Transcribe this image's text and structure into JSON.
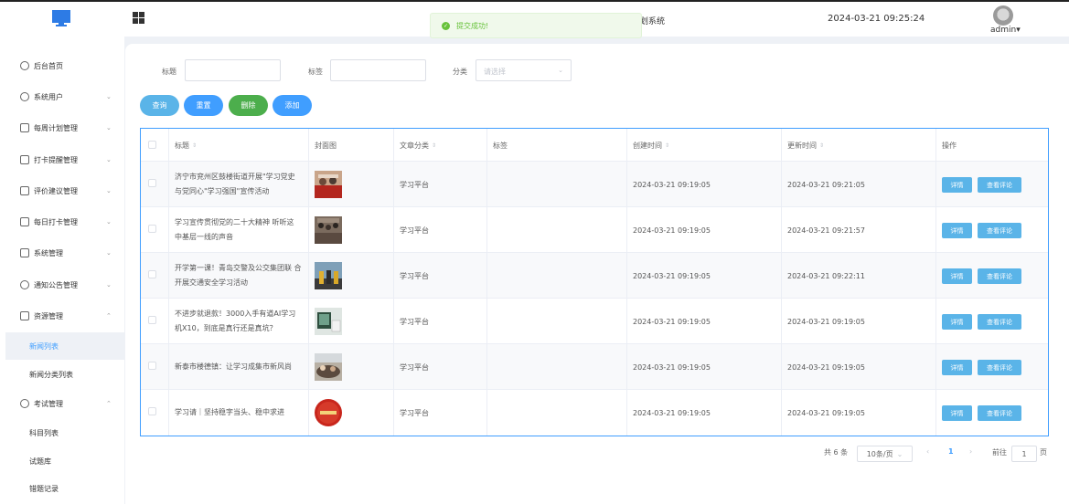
{
  "header": {
    "system_title_partial": "划系统",
    "datetime": "2024-03-21 09:25:24",
    "username": "admin",
    "dropdown_glyph": "▾"
  },
  "toast": {
    "message": "提交成功!",
    "icon": "check-circle-icon"
  },
  "sidebar": {
    "items": [
      {
        "label": "后台首页",
        "icon": "clock-icon"
      },
      {
        "label": "系统用户",
        "icon": "user-icon"
      },
      {
        "label": "每周计划管理",
        "icon": "calendar-icon"
      },
      {
        "label": "打卡提醒管理",
        "icon": "calendar-icon"
      },
      {
        "label": "评价建议管理",
        "icon": "calendar-icon"
      },
      {
        "label": "每日打卡管理",
        "icon": "calendar-icon"
      },
      {
        "label": "系统管理",
        "icon": "folder-icon"
      },
      {
        "label": "通知公告管理",
        "icon": "sun-icon"
      },
      {
        "label": "资源管理",
        "icon": "box-icon"
      },
      {
        "label": "新闻列表"
      },
      {
        "label": "新闻分类列表"
      },
      {
        "label": "考试管理",
        "icon": "headset-icon"
      },
      {
        "label": "科目列表"
      },
      {
        "label": "试题库"
      },
      {
        "label": "错题记录"
      }
    ],
    "chevron_down": "⌄",
    "chevron_up": "⌃"
  },
  "filters": {
    "title_label": "标题",
    "tag_label": "标签",
    "category_label": "分类",
    "category_placeholder": "请选择"
  },
  "buttons": {
    "query": "查询",
    "reset": "重置",
    "delete": "删除",
    "add": "添加"
  },
  "table": {
    "headers": {
      "title": "标题",
      "cover": "封面图",
      "category": "文章分类",
      "tag": "标签",
      "created": "创建时间",
      "updated": "更新时间",
      "actions": "操作"
    },
    "sort_glyph": "⇕",
    "action_detail": "详情",
    "action_comments": "查看评论",
    "rows": [
      {
        "title": "济宁市兖州区鼓楼街道开展\"学习党史 与党同心\"学习强国\"宣传活动",
        "category": "学习平台",
        "tag": "",
        "created": "2024-03-21 09:19:05",
        "updated": "2024-03-21 09:21:05"
      },
      {
        "title": "学习宣传贯彻党的二十大精神 听听这 中基层一线的声音",
        "category": "学习平台",
        "tag": "",
        "created": "2024-03-21 09:19:05",
        "updated": "2024-03-21 09:21:57"
      },
      {
        "title": "开学第一课！青岛交警及公交集团联 合开展交通安全学习活动",
        "category": "学习平台",
        "tag": "",
        "created": "2024-03-21 09:19:05",
        "updated": "2024-03-21 09:22:11"
      },
      {
        "title": "不进步就退款！3000入手有道AI学习 机X10，到底是真行还是真坑？",
        "category": "学习平台",
        "tag": "",
        "created": "2024-03-21 09:19:05",
        "updated": "2024-03-21 09:19:05"
      },
      {
        "title": "新泰市楼德镇：让学习成集市新风尚",
        "category": "学习平台",
        "tag": "",
        "created": "2024-03-21 09:19:05",
        "updated": "2024-03-21 09:19:05"
      },
      {
        "title": "学习请｜坚持稳字当头、稳中求进",
        "category": "学习平台",
        "tag": "",
        "created": "2024-03-21 09:19:05",
        "updated": "2024-03-21 09:19:05"
      }
    ]
  },
  "pagination": {
    "total": "共 6 条",
    "page_size": "10条/页",
    "prev": "‹",
    "current": "1",
    "next": "›",
    "goto_label": "前往",
    "goto_value": "1",
    "page_suffix": "页"
  },
  "colors": {
    "primary": "#409eff",
    "query_btn": "#5ab4e8",
    "reset_btn": "#409eff",
    "delete_btn": "#4cae4c",
    "add_btn": "#409eff",
    "success": "#67c23a"
  }
}
